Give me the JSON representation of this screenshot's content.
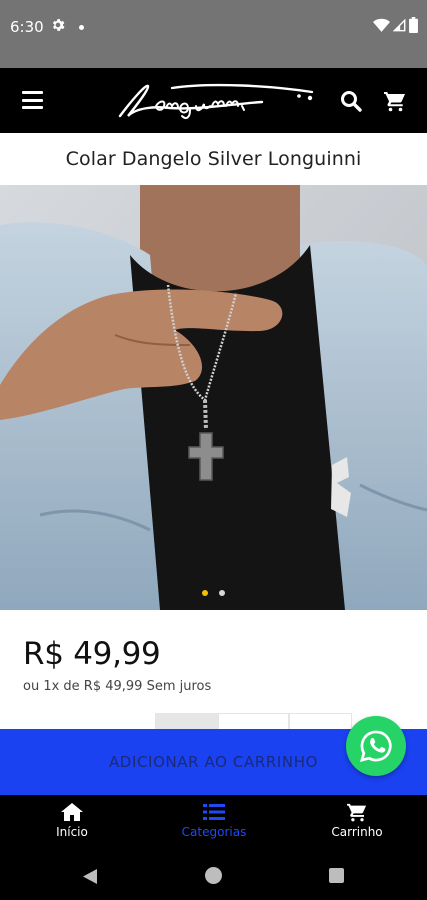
{
  "status_bar": {
    "time": "6:30",
    "icons": [
      "gear-icon",
      "notification-dot-icon",
      "wifi-icon",
      "signal-icon",
      "battery-icon"
    ]
  },
  "header": {
    "brand": "Longuinni",
    "icons": [
      "menu-icon",
      "search-icon",
      "cart-icon"
    ],
    "background": "#000000"
  },
  "product": {
    "title": "Colar Dangelo Silver Longuinni",
    "price": "R$ 49,99",
    "installments": "ou 1x de R$ 49,99 Sem juros",
    "carousel": {
      "total": 2,
      "active": 1
    }
  },
  "actions": {
    "add_to_cart": "ADICIONAR AO CARRINHO",
    "button_color": "#1a42f0"
  },
  "bottom_nav": {
    "items": [
      {
        "label": "Início",
        "icon": "home-icon",
        "active": false
      },
      {
        "label": "Categorias",
        "icon": "list-icon",
        "active": true
      },
      {
        "label": "Carrinho",
        "icon": "cart-icon",
        "active": false
      }
    ],
    "active_color": "#1e4af5"
  },
  "whatsapp": {
    "icon": "whatsapp-icon",
    "color": "#25d366"
  }
}
